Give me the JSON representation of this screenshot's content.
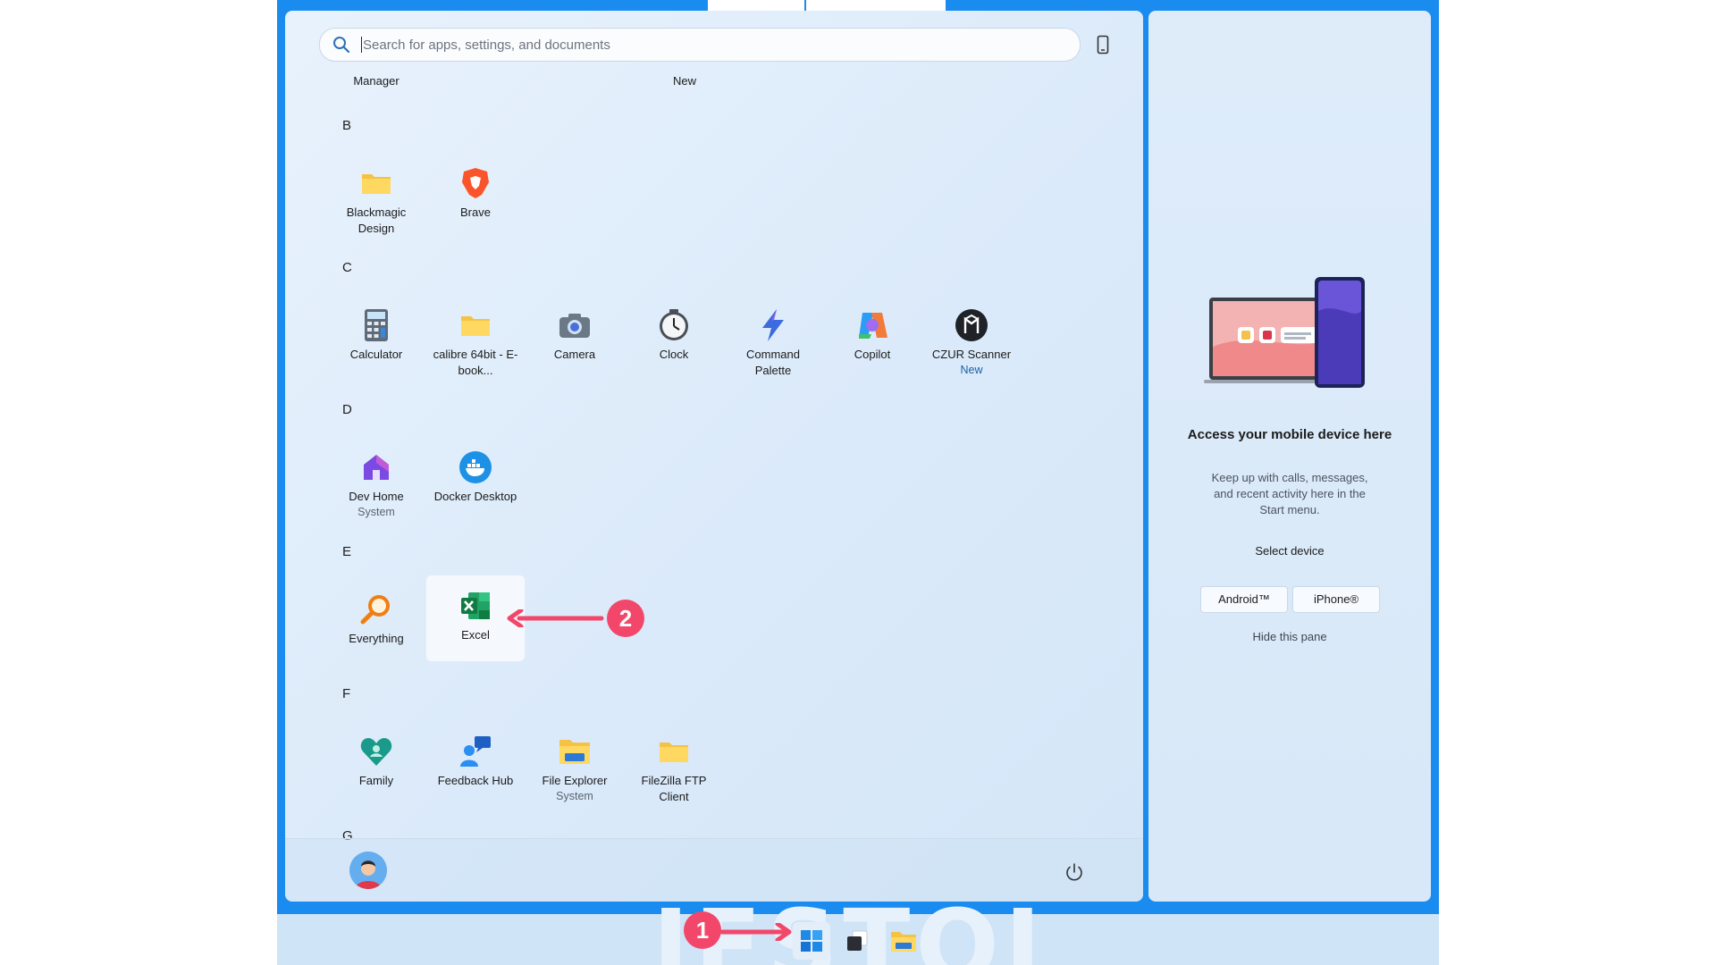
{
  "search": {
    "placeholder": "Search for apps, settings, and documents"
  },
  "top_fragments": [
    "Manager",
    "New"
  ],
  "groups": [
    {
      "letter": "B",
      "apps": [
        {
          "name": "Blackmagic Design",
          "sub": "",
          "icon": "folder-icon"
        },
        {
          "name": "Brave",
          "sub": "",
          "icon": "brave-icon"
        }
      ]
    },
    {
      "letter": "C",
      "apps": [
        {
          "name": "Calculator",
          "sub": "",
          "icon": "calculator-icon"
        },
        {
          "name": "calibre 64bit - E-book...",
          "sub": "",
          "icon": "folder-icon"
        },
        {
          "name": "Camera",
          "sub": "",
          "icon": "camera-icon"
        },
        {
          "name": "Clock",
          "sub": "",
          "icon": "clock-icon"
        },
        {
          "name": "Command Palette",
          "sub": "",
          "icon": "lightning-icon"
        },
        {
          "name": "Copilot",
          "sub": "",
          "icon": "copilot-icon"
        },
        {
          "name": "CZUR Scanner",
          "sub": "New",
          "icon": "scanner-icon"
        }
      ]
    },
    {
      "letter": "D",
      "apps": [
        {
          "name": "Dev Home",
          "sub": "System",
          "icon": "dev-home-icon"
        },
        {
          "name": "Docker Desktop",
          "sub": "",
          "icon": "docker-icon"
        }
      ]
    },
    {
      "letter": "E",
      "apps": [
        {
          "name": "Everything",
          "sub": "",
          "icon": "magnifier-icon"
        },
        {
          "name": "Excel",
          "sub": "",
          "icon": "excel-icon"
        }
      ]
    },
    {
      "letter": "F",
      "apps": [
        {
          "name": "Family",
          "sub": "",
          "icon": "family-heart-icon"
        },
        {
          "name": "Feedback Hub",
          "sub": "",
          "icon": "feedback-icon"
        },
        {
          "name": "File Explorer",
          "sub": "System",
          "icon": "file-explorer-icon"
        },
        {
          "name": "FileZilla FTP Client",
          "sub": "",
          "icon": "folder-icon"
        }
      ]
    },
    {
      "letter": "G",
      "apps": []
    }
  ],
  "mobile_pane": {
    "title": "Access your mobile device here",
    "description": "Keep up with calls, messages, and recent activity here in the Start menu.",
    "select_label": "Select device",
    "android_label": "Android™",
    "iphone_label": "iPhone®",
    "hide_label": "Hide this pane"
  },
  "annotations": {
    "step1": "1",
    "step2": "2"
  },
  "colors": {
    "accent": "#f2476a",
    "desktop": "#1a8cf0",
    "taskbar": "#cfe4f7"
  }
}
